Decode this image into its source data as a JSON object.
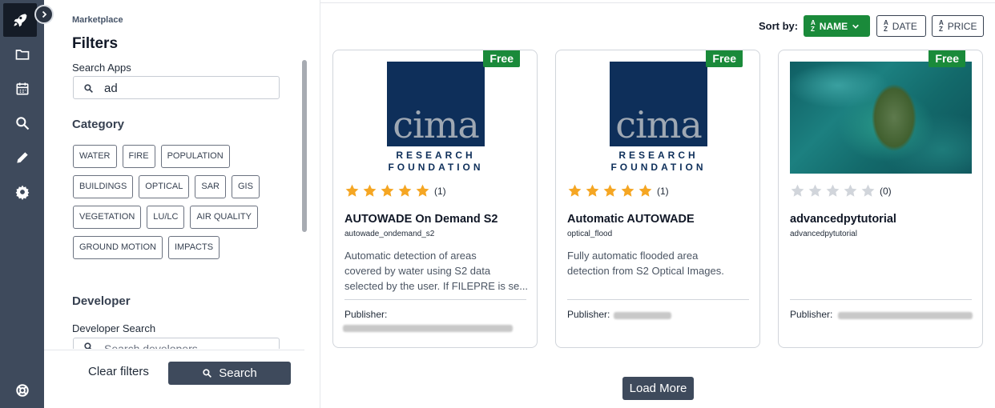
{
  "sidebar": {
    "icons": [
      "rocket-icon",
      "folder-icon",
      "calendar-icon",
      "search-icon",
      "pencil-icon",
      "gear-icon",
      "help-icon"
    ],
    "expand_icon": "chevron-right-icon"
  },
  "filters": {
    "eyebrow": "Marketplace",
    "title": "Filters",
    "search_label": "Search Apps",
    "search_value": "ad",
    "category_title": "Category",
    "chips": [
      [
        "WATER",
        "FIRE",
        "POPULATION"
      ],
      [
        "BUILDINGS",
        "OPTICAL",
        "SAR",
        "GIS"
      ],
      [
        "VEGETATION",
        "LU/LC",
        "AIR QUALITY"
      ],
      [
        "GROUND MOTION",
        "IMPACTS"
      ]
    ],
    "developer_title": "Developer",
    "developer_label": "Developer Search",
    "developer_placeholder": "Search developers",
    "clear_label": "Clear filters",
    "search_button": "Search"
  },
  "sort": {
    "label": "Sort by:",
    "options": [
      {
        "label": "NAME",
        "active": true
      },
      {
        "label": "DATE",
        "active": false
      },
      {
        "label": "PRICE",
        "active": false
      }
    ],
    "az_top": "A",
    "az_bottom": "Z"
  },
  "cards": [
    {
      "badge": "Free",
      "logo": {
        "word": "cima",
        "line1": "RESEARCH",
        "line2": "FOUNDATION"
      },
      "rating": 5,
      "rating_count": "(1)",
      "title": "AUTOWADE On Demand S2",
      "slug": "autowade_ondemand_s2",
      "description_lines": [
        "Automatic detection of areas",
        "covered by water using S2 data",
        "selected by the user. If FILEPRE is se..."
      ],
      "publisher_label": "Publisher:"
    },
    {
      "badge": "Free",
      "logo": {
        "word": "cima",
        "line1": "RESEARCH",
        "line2": "FOUNDATION"
      },
      "rating": 5,
      "rating_count": "(1)",
      "title": "Automatic AUTOWADE",
      "slug": "optical_flood",
      "description_lines": [
        "Fully automatic flooded area",
        "detection from S2 Optical Images."
      ],
      "publisher_label": "Publisher:"
    },
    {
      "badge": "Free",
      "rating": 0,
      "rating_count": "(0)",
      "title": "advancedpytutorial",
      "slug": "advancedpytutorial",
      "description_lines": [],
      "publisher_label": "Publisher:"
    }
  ],
  "load_more": "Load More",
  "colors": {
    "rail": "#3e4a5c",
    "accent_green": "#1a8a3a",
    "star": "#f5a623",
    "star_empty": "#d1d5db",
    "navy": "#0e2f5a"
  }
}
